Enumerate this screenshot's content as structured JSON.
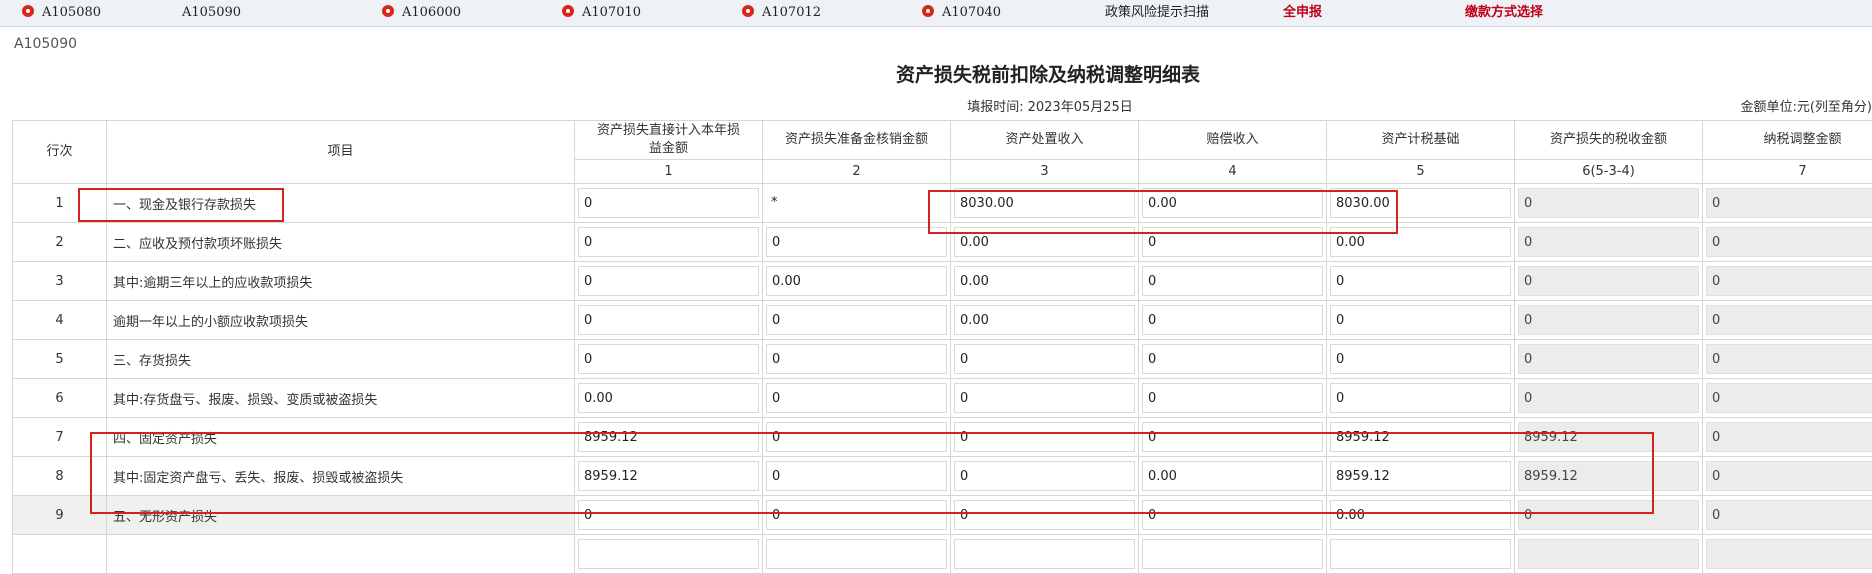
{
  "tabs": [
    {
      "name": "tab-a105080",
      "label": "A105080",
      "icon": "gear-icon",
      "style": "icon"
    },
    {
      "name": "tab-a105090",
      "label": "A105090",
      "icon": "gear-icon",
      "style": "icon-hidden"
    },
    {
      "name": "tab-a106000",
      "label": "A106000",
      "icon": "gear-icon",
      "style": "icon"
    },
    {
      "name": "tab-a107010",
      "label": "A107010",
      "icon": "gear-icon",
      "style": "icon"
    },
    {
      "name": "tab-a107012",
      "label": "A107012",
      "icon": "gear-icon",
      "style": "icon"
    },
    {
      "name": "tab-a107040",
      "label": "A107040",
      "icon": "gear-icon",
      "style": "icon"
    },
    {
      "name": "tab-policy-risk-scan",
      "label": "政策风险提示扫描",
      "style": "plain"
    },
    {
      "name": "tab-full-declare",
      "label": "全申报",
      "style": "red"
    },
    {
      "name": "tab-payment-method",
      "label": "缴款方式选择",
      "style": "red"
    }
  ],
  "form_code": "A105090",
  "title": "资产损失税前扣除及纳税调整明细表",
  "fill_date_label": "填报时间:",
  "fill_date": "2023年05月25日",
  "unit_label": "金额单位:元(列至角分)",
  "columns": {
    "row_no": "行次",
    "item": "项目",
    "c1": "资产损失直接计入本年损益金额",
    "c2": "资产损失准备金核销金额",
    "c3": "资产处置收入",
    "c4": "赔偿收入",
    "c5": "资产计税基础",
    "c6": "资产损失的税收金额",
    "c7": "纳税调整金额"
  },
  "column_numbers": [
    "1",
    "2",
    "3",
    "4",
    "5",
    "6(5-3-4)",
    "7"
  ],
  "rows": [
    {
      "no": "1",
      "item": "一、现金及银行存款损失",
      "values": [
        "0",
        "*",
        "8030.00",
        "0.00",
        "8030.00",
        "0",
        "0"
      ]
    },
    {
      "no": "2",
      "item": "二、应收及预付款项坏账损失",
      "values": [
        "0",
        "0",
        "0.00",
        "0",
        "0.00",
        "0",
        "0"
      ]
    },
    {
      "no": "3",
      "item": "其中:逾期三年以上的应收款项损失",
      "values": [
        "0",
        "0.00",
        "0.00",
        "0",
        "0",
        "0",
        "0"
      ]
    },
    {
      "no": "4",
      "item": "逾期一年以上的小额应收款项损失",
      "values": [
        "0",
        "0",
        "0.00",
        "0",
        "0",
        "0",
        "0"
      ]
    },
    {
      "no": "5",
      "item": "三、存货损失",
      "values": [
        "0",
        "0",
        "0",
        "0",
        "0",
        "0",
        "0"
      ]
    },
    {
      "no": "6",
      "item": "其中:存货盘亏、报废、损毁、变质或被盗损失",
      "values": [
        "0.00",
        "0",
        "0",
        "0",
        "0",
        "0",
        "0"
      ]
    },
    {
      "no": "7",
      "item": "四、固定资产损失",
      "values": [
        "8959.12",
        "0",
        "0",
        "0",
        "8959.12",
        "8959.12",
        "0"
      ]
    },
    {
      "no": "8",
      "item": "其中:固定资产盘亏、丢失、报废、损毁或被盗损失",
      "values": [
        "8959.12",
        "0",
        "0",
        "0.00",
        "8959.12",
        "8959.12",
        "0"
      ]
    },
    {
      "no": "9",
      "item": "五、无形资产损失",
      "values": [
        "0",
        "0",
        "0",
        "0",
        "0.00",
        "0",
        "0"
      ]
    },
    {
      "no": "",
      "item": "",
      "values": [
        "",
        "",
        "",
        "",
        "",
        "",
        ""
      ]
    }
  ]
}
